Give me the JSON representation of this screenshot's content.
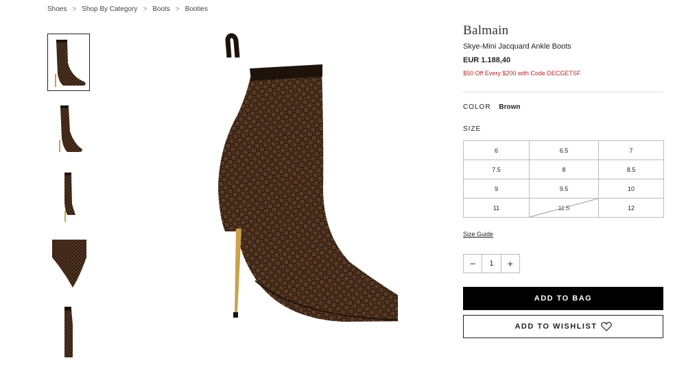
{
  "breadcrumb": [
    {
      "label": "Shoes"
    },
    {
      "label": "Shop By Category"
    },
    {
      "label": "Boots"
    },
    {
      "label": "Booties"
    }
  ],
  "breadcrumb_separator": ">",
  "product": {
    "brand": "Balmain",
    "name": "Skye-Mini Jacquard Ankle Boots",
    "price": "EUR 1.188,40",
    "promo": "$50 Off Every $200 with Code DECGETSF"
  },
  "color": {
    "label": "COLOR",
    "value": "Brown"
  },
  "size": {
    "label": "SIZE",
    "options": [
      "6",
      "6.5",
      "7",
      "7.5",
      "8",
      "8.5",
      "9",
      "9.5",
      "10",
      "11",
      "11.5",
      "12"
    ],
    "unavailable": [
      "11.5"
    ]
  },
  "size_guide": "Size Guide",
  "quantity": {
    "minus": "−",
    "value": "1",
    "plus": "+"
  },
  "buttons": {
    "add_to_bag": "ADD TO BAG",
    "add_to_wishlist": "ADD TO WISHLIST"
  },
  "colors": {
    "boot_brown": "#5a3b24",
    "pattern_dark": "#2a1a10",
    "heel_gold": "#c9a24a",
    "promo_red": "#b02a2a"
  }
}
